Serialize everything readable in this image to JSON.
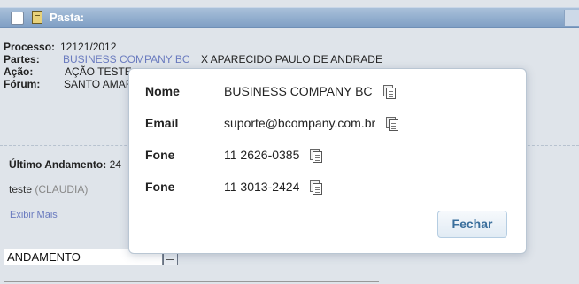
{
  "header": {
    "title": "Pasta:"
  },
  "processo": {
    "processo_label": "Processo:",
    "processo_value": "12121/2012",
    "partes_label": "Partes:",
    "partes_link": "BUSINESS COMPANY BC",
    "partes_rest": "X APARECIDO PAULO DE ANDRADE",
    "acao_label": "Ação:",
    "acao_value": "AÇÃO TESTE",
    "forum_label": "Fórum:",
    "forum_value": "SANTO AMARO"
  },
  "ultimo": {
    "label": "Último Andamento:",
    "value": "24"
  },
  "andamento_item": {
    "text": "teste",
    "user": "(CLAUDIA)"
  },
  "exibir_mais": "Exibir Mais",
  "select": {
    "value": "ANDAMENTO"
  },
  "modal": {
    "rows": [
      {
        "label": "Nome",
        "value": "BUSINESS COMPANY BC"
      },
      {
        "label": "Email",
        "value": "suporte@bcompany.com.br"
      },
      {
        "label": "Fone",
        "value": "11 2626-0385"
      },
      {
        "label": "Fone",
        "value": "11 3013-2424"
      }
    ],
    "close_label": "Fechar"
  },
  "icons": {
    "checkbox": "checkbox-icon",
    "folder": "document-icon",
    "copy": "copy-icon"
  }
}
